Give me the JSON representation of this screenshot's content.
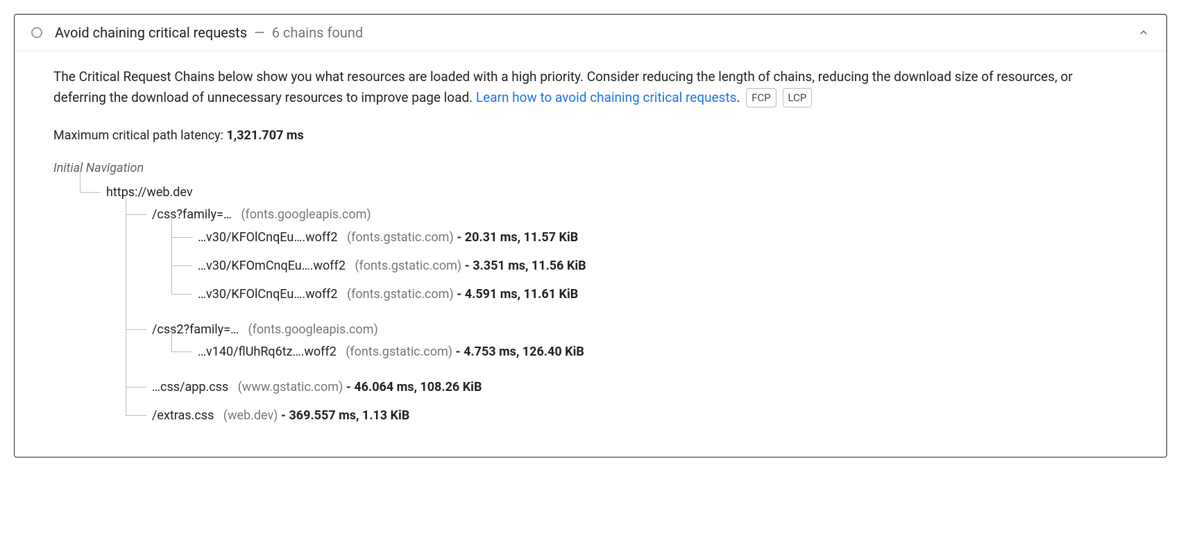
{
  "header": {
    "title": "Avoid chaining critical requests",
    "summary": "6 chains found"
  },
  "description": {
    "text_before_link": "The Critical Request Chains below show you what resources are loaded with a high priority. Consider reducing the length of chains, reducing the download size of resources, or deferring the download of unnecessary resources to improve page load. ",
    "link_text": "Learn how to avoid chaining critical requests",
    "period": ".",
    "tags": [
      "FCP",
      "LCP"
    ]
  },
  "latency": {
    "label": "Maximum critical path latency: ",
    "value": "1,321.707 ms"
  },
  "initial_nav_label": "Initial Navigation",
  "tree": {
    "root": {
      "path": "https://web.dev",
      "host": "",
      "stats": ""
    },
    "children": [
      {
        "path": "/css?family=…",
        "host": "(fonts.googleapis.com)",
        "stats": "",
        "children": [
          {
            "path": "…v30/KFOlCnqEu….woff2",
            "host": "(fonts.gstatic.com)",
            "stats": "- 20.31 ms, 11.57 KiB"
          },
          {
            "path": "…v30/KFOmCnqEu….woff2",
            "host": "(fonts.gstatic.com)",
            "stats": "- 3.351 ms, 11.56 KiB"
          },
          {
            "path": "…v30/KFOlCnqEu….woff2",
            "host": "(fonts.gstatic.com)",
            "stats": "- 4.591 ms, 11.61 KiB"
          }
        ]
      },
      {
        "path": "/css2?family=…",
        "host": "(fonts.googleapis.com)",
        "stats": "",
        "children": [
          {
            "path": "…v140/flUhRq6tz….woff2",
            "host": "(fonts.gstatic.com)",
            "stats": "- 4.753 ms, 126.40 KiB"
          }
        ]
      },
      {
        "path": "…css/app.css",
        "host": "(www.gstatic.com)",
        "stats": "- 46.064 ms, 108.26 KiB"
      },
      {
        "path": "/extras.css",
        "host": "(web.dev)",
        "stats": "- 369.557 ms, 1.13 KiB"
      }
    ]
  }
}
